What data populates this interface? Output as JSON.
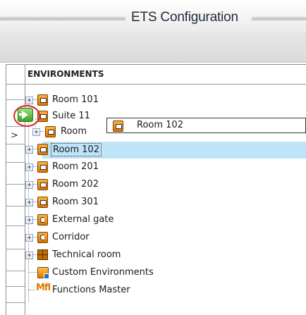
{
  "window": {
    "title": "ETS Configuration"
  },
  "grid": {
    "column_header": "ENVIRONMENTS"
  },
  "tree": {
    "nodes": [
      {
        "label": "Room 101",
        "icon": "room-icon"
      },
      {
        "label": "Suite 11",
        "icon": "room-icon"
      },
      {
        "label": "Room 101",
        "icon": "room-icon"
      },
      {
        "label": "Room 102",
        "icon": "room-icon",
        "selected": true
      },
      {
        "label": "Room 201",
        "icon": "room-icon"
      },
      {
        "label": "Room 202",
        "icon": "room-icon"
      },
      {
        "label": "Room 301",
        "icon": "room-icon"
      },
      {
        "label": "External gate",
        "icon": "gate-icon"
      },
      {
        "label": "Corridor",
        "icon": "gate-icon"
      },
      {
        "label": "Technical room",
        "icon": "technical-room-icon"
      },
      {
        "label": "Custom Environments",
        "icon": "custom-environments-icon"
      },
      {
        "label": "Functions Master",
        "icon": "functions-master-icon"
      }
    ]
  },
  "drag": {
    "label": "Room 102"
  },
  "gutter": {
    "current_row_marker": ">"
  },
  "icons": {
    "master_glyph": "Mfl",
    "expand": "+"
  },
  "colors": {
    "selection": "#bfe4f8",
    "drop_ring": "#d8262b",
    "drop_arrow": "#3ea021",
    "room_icon": "#e07400"
  }
}
